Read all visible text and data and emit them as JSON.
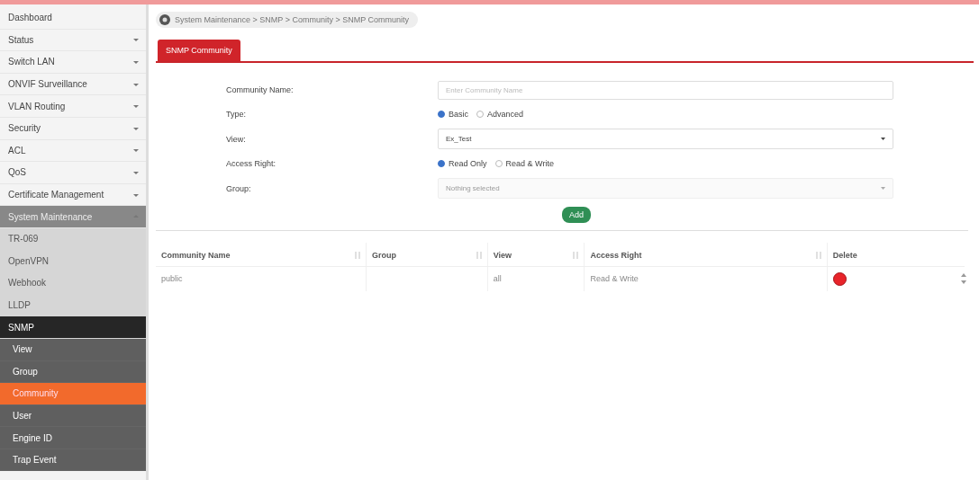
{
  "sidebar": {
    "items": [
      {
        "label": "Dashboard",
        "selected": false
      },
      {
        "label": "Status",
        "expanded": false
      },
      {
        "label": "Switch LAN",
        "expanded": false
      },
      {
        "label": "ONVIF Surveillance",
        "expanded": false
      },
      {
        "label": "VLAN Routing",
        "expanded": false
      },
      {
        "label": "Security",
        "expanded": false
      },
      {
        "label": "ACL",
        "expanded": false
      },
      {
        "label": "QoS",
        "expanded": false
      },
      {
        "label": "Certificate Management",
        "expanded": false
      },
      {
        "label": "System Maintenance",
        "expanded": true,
        "children": [
          {
            "label": "TR-069",
            "selected": false
          },
          {
            "label": "OpenVPN",
            "selected": false
          },
          {
            "label": "Webhook",
            "selected": false
          },
          {
            "label": "LLDP",
            "selected": false
          },
          {
            "label": "SNMP",
            "expanded": true,
            "children": [
              {
                "label": "View",
                "selected": false
              },
              {
                "label": "Group",
                "selected": false
              },
              {
                "label": "Community",
                "selected": true
              },
              {
                "label": "User",
                "selected": false
              },
              {
                "label": "Engine ID",
                "selected": false
              },
              {
                "label": "Trap Event",
                "selected": false
              }
            ]
          }
        ]
      }
    ]
  },
  "breadcrumb": "System Maintenance > SNMP > Community > SNMP Community",
  "tabs": [
    {
      "label": "SNMP Community",
      "selected": true
    }
  ],
  "form": {
    "fields": [
      {
        "label": "Community Name:",
        "kind": "input",
        "placeholder": "Enter Community Name"
      },
      {
        "label": "Type:",
        "kind": "radio",
        "options": [
          {
            "label": "Basic",
            "selected": true
          },
          {
            "label": "Advanced",
            "selected": false
          }
        ]
      },
      {
        "label": "View:",
        "kind": "select",
        "value": "Ex_Test",
        "disabled": false
      },
      {
        "label": "Access Right:",
        "kind": "radio",
        "options": [
          {
            "label": "Read Only",
            "selected": true
          },
          {
            "label": "Read & Write",
            "selected": false
          }
        ]
      },
      {
        "label": "Group:",
        "kind": "select",
        "placeholder": "Nothing selected",
        "disabled": true
      }
    ],
    "button": "Add"
  },
  "table": {
    "columns": [
      {
        "label": "Community Name",
        "sortable": true
      },
      {
        "label": "Group",
        "sortable": true
      },
      {
        "label": "View",
        "sortable": true
      },
      {
        "label": "Access Right",
        "sortable": true
      },
      {
        "label": "Delete",
        "sortable": false
      }
    ],
    "rows": [
      {
        "cells": [
          "public",
          "",
          "all",
          "Read & Write"
        ],
        "delete": true
      }
    ]
  }
}
